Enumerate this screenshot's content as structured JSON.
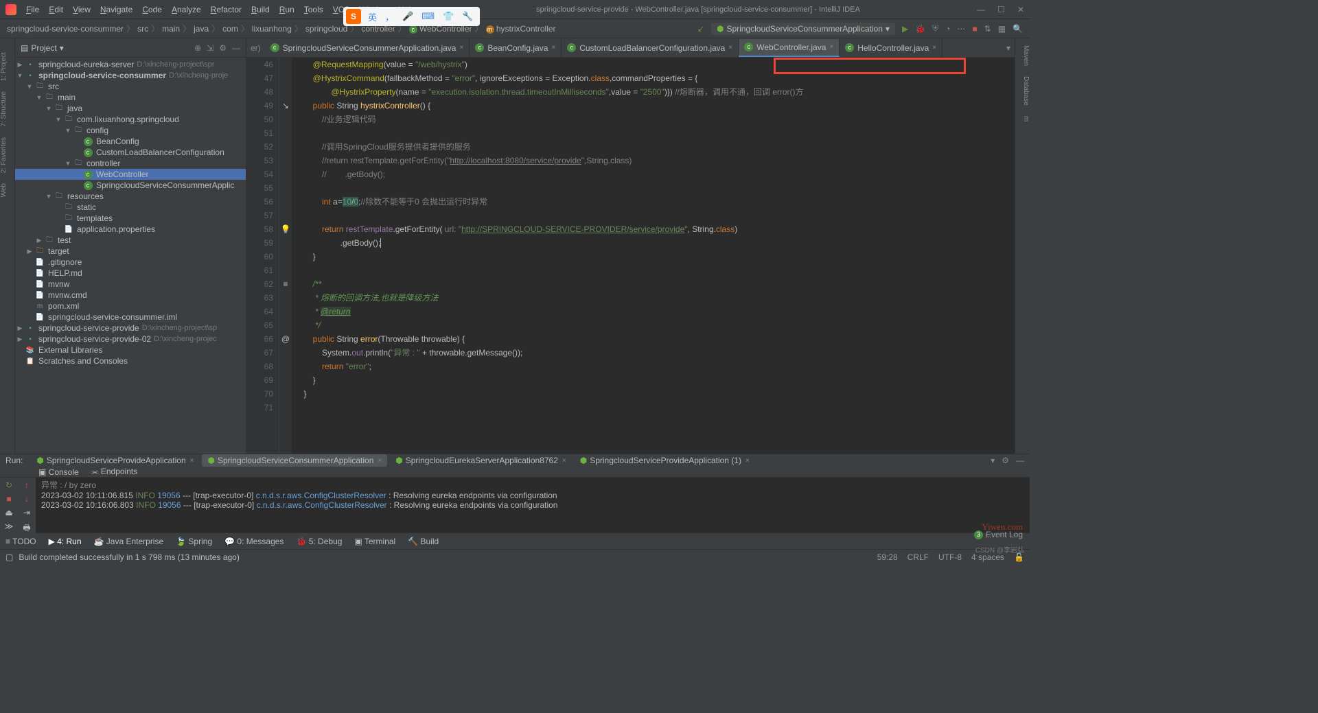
{
  "window": {
    "title": "springcloud-service-provide - WebController.java [springcloud-service-consummer] - IntelliJ IDEA"
  },
  "menu": [
    "File",
    "Edit",
    "View",
    "Navigate",
    "Code",
    "Analyze",
    "Refactor",
    "Build",
    "Run",
    "Tools",
    "VCS",
    "Window",
    "Help"
  ],
  "sogou": {
    "label": "英"
  },
  "breadcrumb": {
    "items": [
      "springcloud-service-consummer",
      "src",
      "main",
      "java",
      "com",
      "lixuanhong",
      "springcloud",
      "controller"
    ],
    "class": "WebController",
    "method": "hystrixController"
  },
  "run_config": "SpringcloudServiceConsummerApplication",
  "project": {
    "title": "Project",
    "tree": [
      {
        "d": 0,
        "arrow": "▶",
        "icon": "module",
        "label": "springcloud-eureka-server",
        "path": "D:\\xincheng-project\\spr"
      },
      {
        "d": 0,
        "arrow": "▼",
        "icon": "module",
        "label": "springcloud-service-consummer",
        "path": "D:\\xincheng-proje",
        "bold": true
      },
      {
        "d": 1,
        "arrow": "▼",
        "icon": "folder",
        "label": "src"
      },
      {
        "d": 2,
        "arrow": "▼",
        "icon": "folder",
        "label": "main"
      },
      {
        "d": 3,
        "arrow": "▼",
        "icon": "folder",
        "label": "java",
        "cls": "module"
      },
      {
        "d": 4,
        "arrow": "▼",
        "icon": "pkg",
        "label": "com.lixuanhong.springcloud"
      },
      {
        "d": 5,
        "arrow": "▼",
        "icon": "pkg",
        "label": "config"
      },
      {
        "d": 6,
        "arrow": "",
        "icon": "c",
        "label": "BeanConfig"
      },
      {
        "d": 6,
        "arrow": "",
        "icon": "c",
        "label": "CustomLoadBalancerConfiguration"
      },
      {
        "d": 5,
        "arrow": "▼",
        "icon": "pkg",
        "label": "controller"
      },
      {
        "d": 6,
        "arrow": "",
        "icon": "c",
        "label": "WebController",
        "selected": true
      },
      {
        "d": 6,
        "arrow": "",
        "icon": "c",
        "label": "SpringcloudServiceConsummerApplic"
      },
      {
        "d": 3,
        "arrow": "▼",
        "icon": "res",
        "label": "resources"
      },
      {
        "d": 4,
        "arrow": "",
        "icon": "folder",
        "label": "static"
      },
      {
        "d": 4,
        "arrow": "",
        "icon": "folder",
        "label": "templates"
      },
      {
        "d": 4,
        "arrow": "",
        "icon": "file",
        "label": "application.properties"
      },
      {
        "d": 2,
        "arrow": "▶",
        "icon": "folder",
        "label": "test"
      },
      {
        "d": 1,
        "arrow": "▶",
        "icon": "folder-o",
        "label": "target"
      },
      {
        "d": 1,
        "arrow": "",
        "icon": "file",
        "label": ".gitignore"
      },
      {
        "d": 1,
        "arrow": "",
        "icon": "file",
        "label": "HELP.md"
      },
      {
        "d": 1,
        "arrow": "",
        "icon": "file",
        "label": "mvnw"
      },
      {
        "d": 1,
        "arrow": "",
        "icon": "file",
        "label": "mvnw.cmd"
      },
      {
        "d": 1,
        "arrow": "",
        "icon": "mvn",
        "label": "pom.xml"
      },
      {
        "d": 1,
        "arrow": "",
        "icon": "file",
        "label": "springcloud-service-consummer.iml"
      },
      {
        "d": 0,
        "arrow": "▶",
        "icon": "module",
        "label": "springcloud-service-provide",
        "path": "D:\\xincheng-project\\sp"
      },
      {
        "d": 0,
        "arrow": "▶",
        "icon": "module",
        "label": "springcloud-service-provide-02",
        "path": "D:\\xincheng-projec"
      },
      {
        "d": 0,
        "arrow": "",
        "icon": "lib",
        "label": "External Libraries"
      },
      {
        "d": 0,
        "arrow": "",
        "icon": "scratch",
        "label": "Scratches and Consoles"
      }
    ]
  },
  "tabs": [
    {
      "label": "SpringcloudServiceConsummerApplication.java",
      "active": false,
      "trunc": "er)"
    },
    {
      "label": "BeanConfig.java",
      "active": false
    },
    {
      "label": "CustomLoadBalancerConfiguration.java",
      "active": false
    },
    {
      "label": "WebController.java",
      "active": true
    },
    {
      "label": "HelloController.java",
      "active": false
    }
  ],
  "code": {
    "start": 46,
    "lines": [
      {
        "n": 46,
        "html": "        <span class='a'>@RequestMapping</span>(value = <span class='s'>\"/web/hystrix\"</span>)"
      },
      {
        "n": 47,
        "html": "        <span class='a'>@HystrixCommand</span>(fallbackMethod = <span class='s'>\"error\"</span>, ignoreExceptions = Exception.<span class='k'>class</span>,commandProperties = {"
      },
      {
        "n": 48,
        "html": "                <span class='a'>@HystrixProperty</span>(name = <span class='s'>\"execution.isolation.thread.timeoutInMilliseconds\"</span>,value = <span class='s'>\"2500\"</span>)}) <span class='c'>//熔断器，调用不通，回调 error()方</span>"
      },
      {
        "n": 49,
        "html": "        <span class='k'>public</span> String <span class='f'>hystrixController</span>() {",
        "gut": "↘"
      },
      {
        "n": 50,
        "html": "            <span class='c'>//业务逻辑代码</span>"
      },
      {
        "n": 51,
        "html": ""
      },
      {
        "n": 52,
        "html": "            <span class='c'>//调用SpringCloud服务提供者提供的服务</span>"
      },
      {
        "n": 53,
        "html": "            <span class='c'>//return restTemplate.getForEntity(\"<u>http://localhost:8080/service/provide</u>\",String.class)</span>"
      },
      {
        "n": 54,
        "html": "            <span class='c'>//        .getBody();</span>"
      },
      {
        "n": 55,
        "html": ""
      },
      {
        "n": 56,
        "html": "            <span class='k'>int</span> a=<span class='hl'><span class='n'>10</span>/<span class='n'>0</span></span>;<span class='c'>//除数不能等于0 会抛出运行时异常</span>"
      },
      {
        "n": 57,
        "html": ""
      },
      {
        "n": 58,
        "html": "            <span class='k'>return</span> <span class='p'>restTemplate</span>.getForEntity( <span class='c'>url:</span> <span class='s'>\"<u>http://SPRINGCLOUD-SERVICE-PROVIDER/service/provide</u>\"</span>, String.<span class='k'>class</span>)",
        "gut": "💡"
      },
      {
        "n": 59,
        "html": "                    .getBody();<span style='border-left:1px solid #bbb'>&#8203;</span>"
      },
      {
        "n": 60,
        "html": "        }",
        "fold": true
      },
      {
        "n": 61,
        "html": ""
      },
      {
        "n": 62,
        "html": "        <span class='doc'>/**</span>",
        "fold": true,
        "ind": "≡"
      },
      {
        "n": 63,
        "html": "         <span class='doc'>* 熔断的回调方法,也就是降级方法</span>"
      },
      {
        "n": 64,
        "html": "         <span class='doc'>* </span><span class='doct'>@return</span>"
      },
      {
        "n": 65,
        "html": "         <span class='doc'>*/</span>"
      },
      {
        "n": 66,
        "html": "        <span class='k'>public</span> String <span class='f'>error</span>(Throwable throwable) {",
        "gut": "@"
      },
      {
        "n": 67,
        "html": "            System.<span class='p'>out</span>.println(<span class='s'>\"异常 : \"</span> + throwable.getMessage());"
      },
      {
        "n": 68,
        "html": "            <span class='k'>return</span> <span class='s'>\"error\"</span>;"
      },
      {
        "n": 69,
        "html": "        }",
        "fold": true
      },
      {
        "n": 70,
        "html": "    }",
        "fold": true
      },
      {
        "n": 71,
        "html": ""
      }
    ]
  },
  "run": {
    "label": "Run:",
    "tabs": [
      {
        "label": "SpringcloudServiceProvideApplication",
        "active": false
      },
      {
        "label": "SpringcloudServiceConsummerApplication",
        "active": true
      },
      {
        "label": "SpringcloudEurekaServerApplication8762",
        "active": false
      },
      {
        "label": "SpringcloudServiceProvideApplication (1)",
        "active": false
      }
    ],
    "sub": [
      "Console",
      "Endpoints"
    ],
    "console": [
      {
        "pre": "异常 : / by zero"
      },
      {
        "ts": "2023-03-02 10:11:06.815",
        "lvl": "INFO",
        "pid": "19056",
        "thr": "[trap-executor-0]",
        "cls": "c.n.d.s.r.aws.ConfigClusterResolver",
        "msg": ": Resolving eureka endpoints via configuration"
      },
      {
        "ts": "2023-03-02 10:16:06.803",
        "lvl": "INFO",
        "pid": "19056",
        "thr": "[trap-executor-0]",
        "cls": "c.n.d.s.r.aws.ConfigClusterResolver",
        "msg": ": Resolving eureka endpoints via configuration"
      }
    ]
  },
  "bottom_tools": [
    "≡ TODO",
    "▶ 4: Run",
    "☕ Java Enterprise",
    "🍃 Spring",
    "💬 0: Messages",
    "🐞 5: Debug",
    "▣ Terminal",
    "🔨 Build"
  ],
  "status": {
    "msg": "Build completed successfully in 1 s 798 ms (13 minutes ago)",
    "event_log_count": "3",
    "event_log": "Event Log",
    "pos": "59:28",
    "eol": "CRLF",
    "enc": "UTF-8",
    "indent": "4 spaces"
  },
  "left_tools": [
    "1: Project",
    "7: Structure",
    "2: Favorites",
    "Web"
  ],
  "right_tools": [
    "Maven",
    "Database",
    "m"
  ]
}
